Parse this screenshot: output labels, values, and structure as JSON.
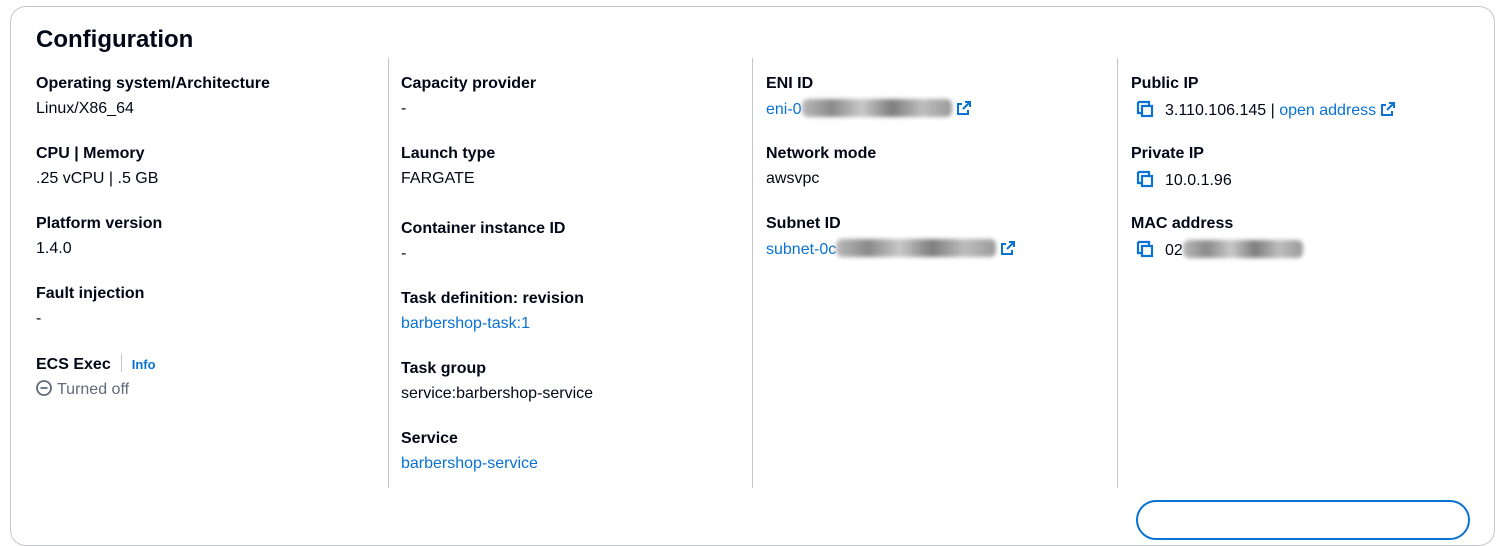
{
  "section": {
    "title": "Configuration"
  },
  "col1": {
    "os_label": "Operating system/Architecture",
    "os_value": "Linux/X86_64",
    "cpu_label": "CPU | Memory",
    "cpu_value": ".25 vCPU | .5 GB",
    "platform_label": "Platform version",
    "platform_value": "1.4.0",
    "fault_label": "Fault injection",
    "fault_value": "-",
    "exec_label": "ECS Exec",
    "exec_info": "Info",
    "exec_value": "Turned off"
  },
  "col2": {
    "capacity_label": "Capacity provider",
    "capacity_value": "-",
    "launch_label": "Launch type",
    "launch_value": "FARGATE",
    "container_label": "Container instance ID",
    "container_value": "-",
    "taskdef_label": "Task definition: revision",
    "taskdef_value": "barbershop-task:1",
    "group_label": "Task group",
    "group_value": "service:barbershop-service",
    "service_label": "Service",
    "service_value": "barbershop-service"
  },
  "col3": {
    "eni_label": "ENI ID",
    "eni_value": "eni-0",
    "network_label": "Network mode",
    "network_value": "awsvpc",
    "subnet_label": "Subnet ID",
    "subnet_value": "subnet-0c"
  },
  "col4": {
    "public_label": "Public IP",
    "public_value": "3.110.106.145",
    "public_sep": "|",
    "public_link": "open address",
    "private_label": "Private IP",
    "private_value": "10.0.1.96",
    "mac_label": "MAC address",
    "mac_value": "02"
  },
  "colors": {
    "link": "#0972d3",
    "border": "#c6c6cd",
    "text": "#000716",
    "muted": "#5f6b7a"
  },
  "icons": [
    "external-link-icon",
    "copy-icon",
    "status-off-icon"
  ]
}
